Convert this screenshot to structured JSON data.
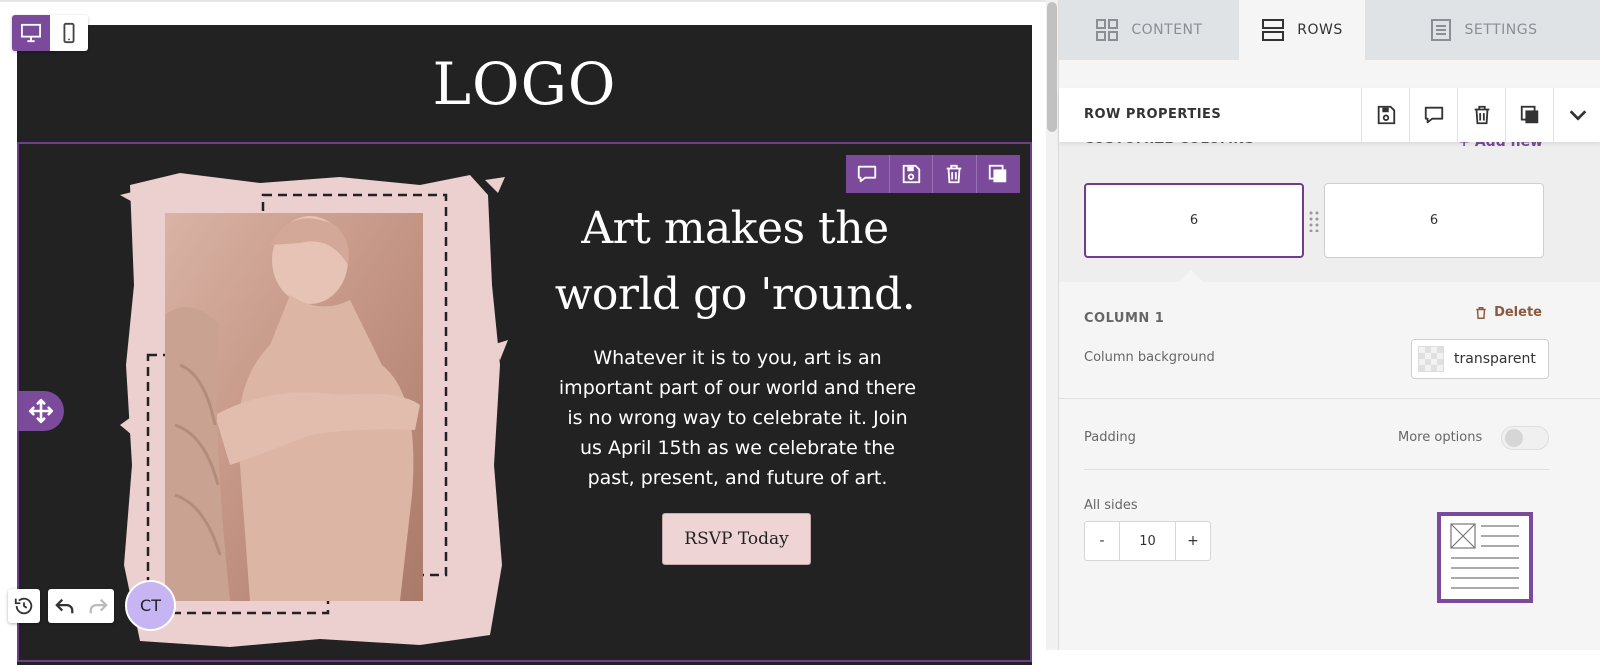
{
  "canvas": {
    "logo_text": "LOGO",
    "headline": "Art makes the world go 'round.",
    "body": "Whatever it is to you, art is an important part of our world and there is no wrong way to celebrate it. Join us April 15th as we celebrate the past, present, and future of art.",
    "cta_label": "RSVP Today"
  },
  "device_toggle": {
    "active": "desktop"
  },
  "row_toolbar": {
    "icons": [
      "comment-icon",
      "save-icon",
      "trash-icon",
      "duplicate-icon"
    ]
  },
  "history": {
    "avatar_initials": "CT"
  },
  "colors": {
    "accent": "#7b4a9b",
    "canvas_bg": "#222222",
    "cta_bg": "#eed4d4",
    "avatar": "#c7b4f3",
    "delete": "#8b5a3c"
  },
  "panel": {
    "tabs": [
      {
        "label": "CONTENT",
        "icon": "grid-icon"
      },
      {
        "label": "ROWS",
        "icon": "rows-icon",
        "active": true
      },
      {
        "label": "SETTINGS",
        "icon": "settings-icon"
      }
    ],
    "header_title": "ROW PROPERTIES",
    "customize_label": "CUSTOMIZE COLUMNS",
    "add_new": "Add new",
    "columns": [
      "6",
      "6"
    ],
    "column_title": "COLUMN 1",
    "delete_label": "Delete",
    "column_background_label": "Column background",
    "column_background_value": "transparent",
    "padding_label": "Padding",
    "more_options_label": "More options",
    "more_options_enabled": false,
    "all_sides_label": "All sides",
    "padding_value": "10",
    "stepper_minus": "-",
    "stepper_plus": "+"
  }
}
